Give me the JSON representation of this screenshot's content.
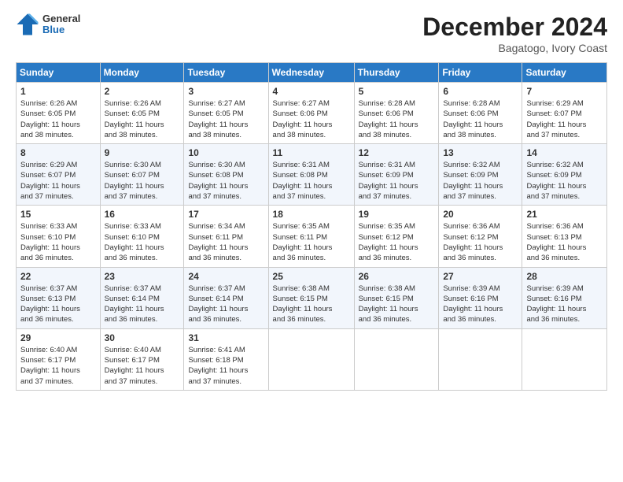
{
  "logo": {
    "general": "General",
    "blue": "Blue"
  },
  "header": {
    "month": "December 2024",
    "location": "Bagatogo, Ivory Coast"
  },
  "weekdays": [
    "Sunday",
    "Monday",
    "Tuesday",
    "Wednesday",
    "Thursday",
    "Friday",
    "Saturday"
  ],
  "weeks": [
    [
      {
        "day": "1",
        "sunrise": "6:26 AM",
        "sunset": "6:05 PM",
        "daylight": "11 hours and 38 minutes."
      },
      {
        "day": "2",
        "sunrise": "6:26 AM",
        "sunset": "6:05 PM",
        "daylight": "11 hours and 38 minutes."
      },
      {
        "day": "3",
        "sunrise": "6:27 AM",
        "sunset": "6:05 PM",
        "daylight": "11 hours and 38 minutes."
      },
      {
        "day": "4",
        "sunrise": "6:27 AM",
        "sunset": "6:06 PM",
        "daylight": "11 hours and 38 minutes."
      },
      {
        "day": "5",
        "sunrise": "6:28 AM",
        "sunset": "6:06 PM",
        "daylight": "11 hours and 38 minutes."
      },
      {
        "day": "6",
        "sunrise": "6:28 AM",
        "sunset": "6:06 PM",
        "daylight": "11 hours and 38 minutes."
      },
      {
        "day": "7",
        "sunrise": "6:29 AM",
        "sunset": "6:07 PM",
        "daylight": "11 hours and 37 minutes."
      }
    ],
    [
      {
        "day": "8",
        "sunrise": "6:29 AM",
        "sunset": "6:07 PM",
        "daylight": "11 hours and 37 minutes."
      },
      {
        "day": "9",
        "sunrise": "6:30 AM",
        "sunset": "6:07 PM",
        "daylight": "11 hours and 37 minutes."
      },
      {
        "day": "10",
        "sunrise": "6:30 AM",
        "sunset": "6:08 PM",
        "daylight": "11 hours and 37 minutes."
      },
      {
        "day": "11",
        "sunrise": "6:31 AM",
        "sunset": "6:08 PM",
        "daylight": "11 hours and 37 minutes."
      },
      {
        "day": "12",
        "sunrise": "6:31 AM",
        "sunset": "6:09 PM",
        "daylight": "11 hours and 37 minutes."
      },
      {
        "day": "13",
        "sunrise": "6:32 AM",
        "sunset": "6:09 PM",
        "daylight": "11 hours and 37 minutes."
      },
      {
        "day": "14",
        "sunrise": "6:32 AM",
        "sunset": "6:09 PM",
        "daylight": "11 hours and 37 minutes."
      }
    ],
    [
      {
        "day": "15",
        "sunrise": "6:33 AM",
        "sunset": "6:10 PM",
        "daylight": "11 hours and 36 minutes."
      },
      {
        "day": "16",
        "sunrise": "6:33 AM",
        "sunset": "6:10 PM",
        "daylight": "11 hours and 36 minutes."
      },
      {
        "day": "17",
        "sunrise": "6:34 AM",
        "sunset": "6:11 PM",
        "daylight": "11 hours and 36 minutes."
      },
      {
        "day": "18",
        "sunrise": "6:35 AM",
        "sunset": "6:11 PM",
        "daylight": "11 hours and 36 minutes."
      },
      {
        "day": "19",
        "sunrise": "6:35 AM",
        "sunset": "6:12 PM",
        "daylight": "11 hours and 36 minutes."
      },
      {
        "day": "20",
        "sunrise": "6:36 AM",
        "sunset": "6:12 PM",
        "daylight": "11 hours and 36 minutes."
      },
      {
        "day": "21",
        "sunrise": "6:36 AM",
        "sunset": "6:13 PM",
        "daylight": "11 hours and 36 minutes."
      }
    ],
    [
      {
        "day": "22",
        "sunrise": "6:37 AM",
        "sunset": "6:13 PM",
        "daylight": "11 hours and 36 minutes."
      },
      {
        "day": "23",
        "sunrise": "6:37 AM",
        "sunset": "6:14 PM",
        "daylight": "11 hours and 36 minutes."
      },
      {
        "day": "24",
        "sunrise": "6:37 AM",
        "sunset": "6:14 PM",
        "daylight": "11 hours and 36 minutes."
      },
      {
        "day": "25",
        "sunrise": "6:38 AM",
        "sunset": "6:15 PM",
        "daylight": "11 hours and 36 minutes."
      },
      {
        "day": "26",
        "sunrise": "6:38 AM",
        "sunset": "6:15 PM",
        "daylight": "11 hours and 36 minutes."
      },
      {
        "day": "27",
        "sunrise": "6:39 AM",
        "sunset": "6:16 PM",
        "daylight": "11 hours and 36 minutes."
      },
      {
        "day": "28",
        "sunrise": "6:39 AM",
        "sunset": "6:16 PM",
        "daylight": "11 hours and 36 minutes."
      }
    ],
    [
      {
        "day": "29",
        "sunrise": "6:40 AM",
        "sunset": "6:17 PM",
        "daylight": "11 hours and 37 minutes."
      },
      {
        "day": "30",
        "sunrise": "6:40 AM",
        "sunset": "6:17 PM",
        "daylight": "11 hours and 37 minutes."
      },
      {
        "day": "31",
        "sunrise": "6:41 AM",
        "sunset": "6:18 PM",
        "daylight": "11 hours and 37 minutes."
      },
      null,
      null,
      null,
      null
    ]
  ]
}
